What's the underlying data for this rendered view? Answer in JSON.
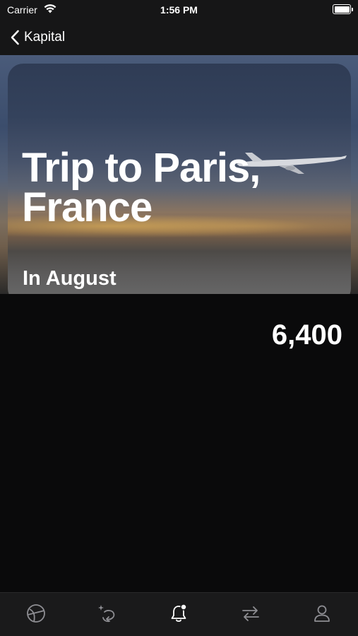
{
  "status_bar": {
    "carrier": "Carrier",
    "time": "1:56 PM"
  },
  "nav": {
    "back_label": "Kapital"
  },
  "hero": {
    "title": "Trip to Paris, France",
    "subtitle": "In August"
  },
  "goal": {
    "amount": "6,400"
  },
  "tab_bar": {
    "icons": [
      "globe-icon",
      "sparkle-transfer-icon",
      "bell-badge-icon",
      "arrows-exchange-icon",
      "person-icon"
    ],
    "active_index": 2
  },
  "colors": {
    "background": "#0a0a0b",
    "bar": "#161617",
    "icon_inactive": "#8e8e93",
    "icon_active": "#ffffff"
  }
}
